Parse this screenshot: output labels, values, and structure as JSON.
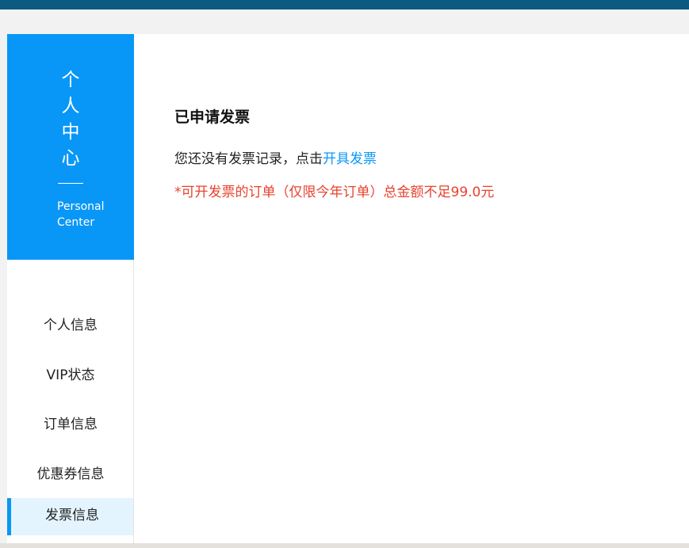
{
  "brand": {
    "title_chars": [
      "个",
      "人",
      "中",
      "心"
    ],
    "subtitle_line1": "Personal",
    "subtitle_line2": "Center"
  },
  "menu": {
    "items": [
      {
        "label": "个人信息"
      },
      {
        "label": "VIP状态"
      },
      {
        "label": "订单信息"
      },
      {
        "label": "优惠券信息"
      },
      {
        "label": "发票信息",
        "active": true
      }
    ]
  },
  "main": {
    "section_title": "已申请发票",
    "empty_text": "您还没有发票记录，点击",
    "empty_link": "开具发票",
    "notice": "*可开发票的订单（仅限今年订单）总金额不足99.0元"
  },
  "colors": {
    "topbar": "#0c5a80",
    "accent": "#0997f7",
    "active_bg": "#e3f4fe",
    "warning": "#e8412c"
  }
}
